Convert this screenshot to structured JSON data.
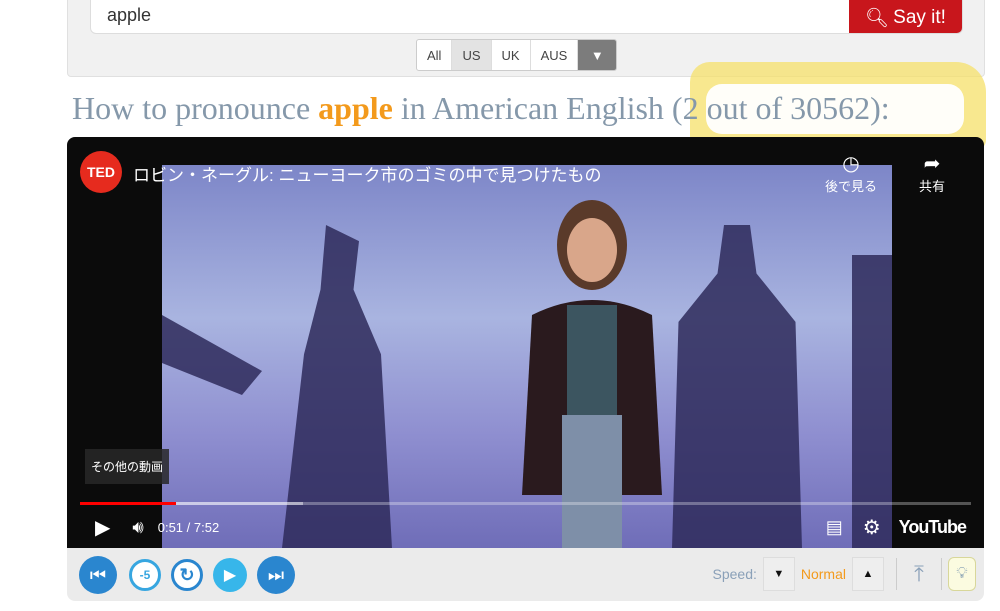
{
  "search": {
    "value": "apple",
    "button_label": "Say it!"
  },
  "regions": [
    {
      "label": "All"
    },
    {
      "label": "US",
      "active": true
    },
    {
      "label": "UK"
    },
    {
      "label": "AUS"
    }
  ],
  "heading": {
    "prefix": "How to pronounce ",
    "word": "apple",
    "suffix": " in American English (2 out of 30562):"
  },
  "video": {
    "channel_logo": "TED",
    "title": "ロビン・ネーグル: ニューヨーク市のゴミの中で見つけたもの",
    "watch_later": "後で見る",
    "share": "共有",
    "more_videos": "その他の動画",
    "time": "0:51 / 7:52",
    "progress_percent": 10.8,
    "buffered_percent": 25,
    "brand": "YouTube"
  },
  "controls": {
    "speed_label": "Speed:",
    "speed_value": "Normal"
  },
  "colors": {
    "accent": "#f39a1c",
    "say_it": "#c8161c",
    "control_blue": "#2a8ad4",
    "highlight": "#f5e06a"
  }
}
